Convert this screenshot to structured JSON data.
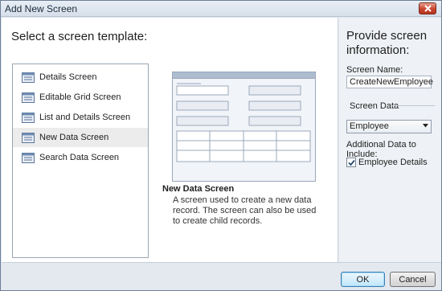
{
  "window": {
    "title": "Add New Screen"
  },
  "main": {
    "heading": "Select a screen template:",
    "templates": [
      {
        "label": "Details Screen",
        "selected": false
      },
      {
        "label": "Editable Grid Screen",
        "selected": false
      },
      {
        "label": "List and Details Screen",
        "selected": false
      },
      {
        "label": "New Data Screen",
        "selected": true
      },
      {
        "label": "Search Data Screen",
        "selected": false
      }
    ],
    "preview": {
      "icon": "new-data-screen-preview"
    },
    "description": {
      "title": "New Data Screen",
      "text": "A screen used to create a new data record. The screen can also be used to create child records."
    }
  },
  "right": {
    "heading": "Provide screen information:",
    "screen_name_label": "Screen Name:",
    "screen_name_value": "CreateNewEmployee",
    "screen_data_label": "Screen Data",
    "screen_data_value": "Employee",
    "additional_label": "Additional Data to Include:",
    "employee_details_label": "Employee Details",
    "employee_details_checked": true
  },
  "footer": {
    "ok_label": "OK",
    "cancel_label": "Cancel"
  },
  "colors": {
    "selected_row": "#ececec",
    "accent": "#3c7fb1",
    "close": "#c9442e"
  }
}
